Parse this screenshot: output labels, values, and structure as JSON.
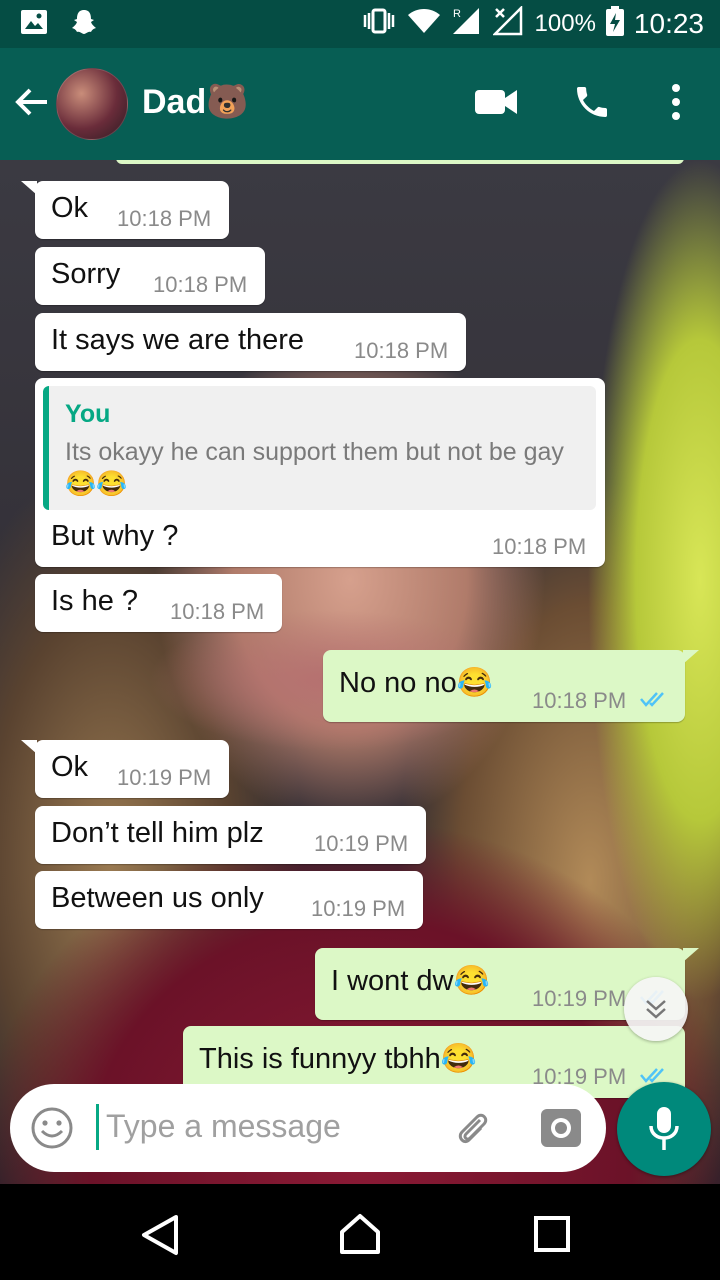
{
  "status_bar": {
    "battery": "100%",
    "time": "10:23"
  },
  "header": {
    "title": "Dad🐻"
  },
  "messages": [
    {
      "dir": "in",
      "text": "Ok",
      "time": "10:18 PM"
    },
    {
      "dir": "in",
      "text": "Sorry",
      "time": "10:18 PM"
    },
    {
      "dir": "in",
      "text": "It says we are there",
      "time": "10:18 PM"
    },
    {
      "dir": "in",
      "quote_author": "You",
      "quote_text": "Its okayy he can support them but not be gay😂😂",
      "text": "But why ?",
      "time": "10:18 PM"
    },
    {
      "dir": "in",
      "text": "Is he ?",
      "time": "10:18 PM"
    },
    {
      "dir": "out",
      "text": "No no no😂",
      "time": "10:18 PM"
    },
    {
      "dir": "in",
      "text": "Ok",
      "time": "10:19 PM"
    },
    {
      "dir": "in",
      "text": "Don’t tell him plz",
      "time": "10:19 PM"
    },
    {
      "dir": "in",
      "text": "Between us only",
      "time": "10:19 PM"
    },
    {
      "dir": "out",
      "text": "I wont dw😂",
      "time": "10:19 PM"
    },
    {
      "dir": "out",
      "text": "This is funnyy tbhh😂",
      "time": "10:19 PM"
    }
  ],
  "composer": {
    "placeholder": "Type a message"
  },
  "colors": {
    "header": "#075e54",
    "status_bar": "#054d44",
    "outgoing": "#dcf8c6",
    "accent": "#00897b",
    "read_ticks": "#4fc3f7"
  }
}
